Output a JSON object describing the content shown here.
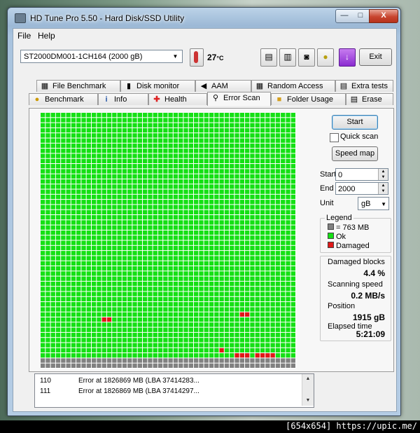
{
  "window": {
    "title": "HD Tune Pro 5.50 - Hard Disk/SSD Utility",
    "min_glyph": "—",
    "max_glyph": "□",
    "close_glyph": "X"
  },
  "menu": {
    "file": "File",
    "help": "Help"
  },
  "toolbar": {
    "drive": "ST2000DM001-1CH164 (2000 gB)",
    "temperature": "27",
    "temperature_unit": "°C",
    "exit_label": "Exit"
  },
  "tabs": {
    "row1": [
      "File Benchmark",
      "Disk monitor",
      "AAM",
      "Random Access",
      "Extra tests"
    ],
    "row2": [
      "Benchmark",
      "Info",
      "Health",
      "Error Scan",
      "Folder Usage",
      "Erase"
    ],
    "active": "Error Scan"
  },
  "controls": {
    "start_label": "Start",
    "quick_scan_label": "Quick scan",
    "quick_scan_checked": false,
    "speed_map_label": "Speed map",
    "start_field_label": "Start",
    "start_value": "0",
    "end_field_label": "End",
    "end_value": "2000",
    "unit_label": "Unit",
    "unit_value": "gB"
  },
  "legend": {
    "title": "Legend",
    "block_size": "= 763 MB",
    "ok": "Ok",
    "damaged": "Damaged",
    "colors": {
      "unscanned": "#808080",
      "ok": "#14e014",
      "damaged": "#e01818"
    }
  },
  "stats": {
    "damaged_blocks_label": "Damaged blocks",
    "damaged_blocks_value": "4.4 %",
    "scanning_speed_label": "Scanning speed",
    "scanning_speed_value": "0.2 MB/s",
    "position_label": "Position",
    "position_value": "1915 gB",
    "elapsed_time_label": "Elapsed time",
    "elapsed_time_value": "5:21:09"
  },
  "error_log": [
    {
      "num": "110",
      "msg": "Error at 1826869 MB (LBA 37414283..."
    },
    {
      "num": "111",
      "msg": "Error at 1826869 MB (LBA 37414297..."
    }
  ],
  "scan_grid": {
    "cols": 50,
    "rows": 50,
    "gray_rows": [
      48,
      49
    ],
    "damaged": [
      [
        12,
        40
      ],
      [
        13,
        40
      ],
      [
        39,
        39
      ],
      [
        40,
        39
      ],
      [
        35,
        46
      ],
      [
        38,
        47
      ],
      [
        39,
        47
      ],
      [
        40,
        47
      ],
      [
        42,
        47
      ],
      [
        43,
        47
      ],
      [
        44,
        47
      ],
      [
        45,
        47
      ]
    ]
  },
  "footer": "[654x654] https://upic.me/"
}
